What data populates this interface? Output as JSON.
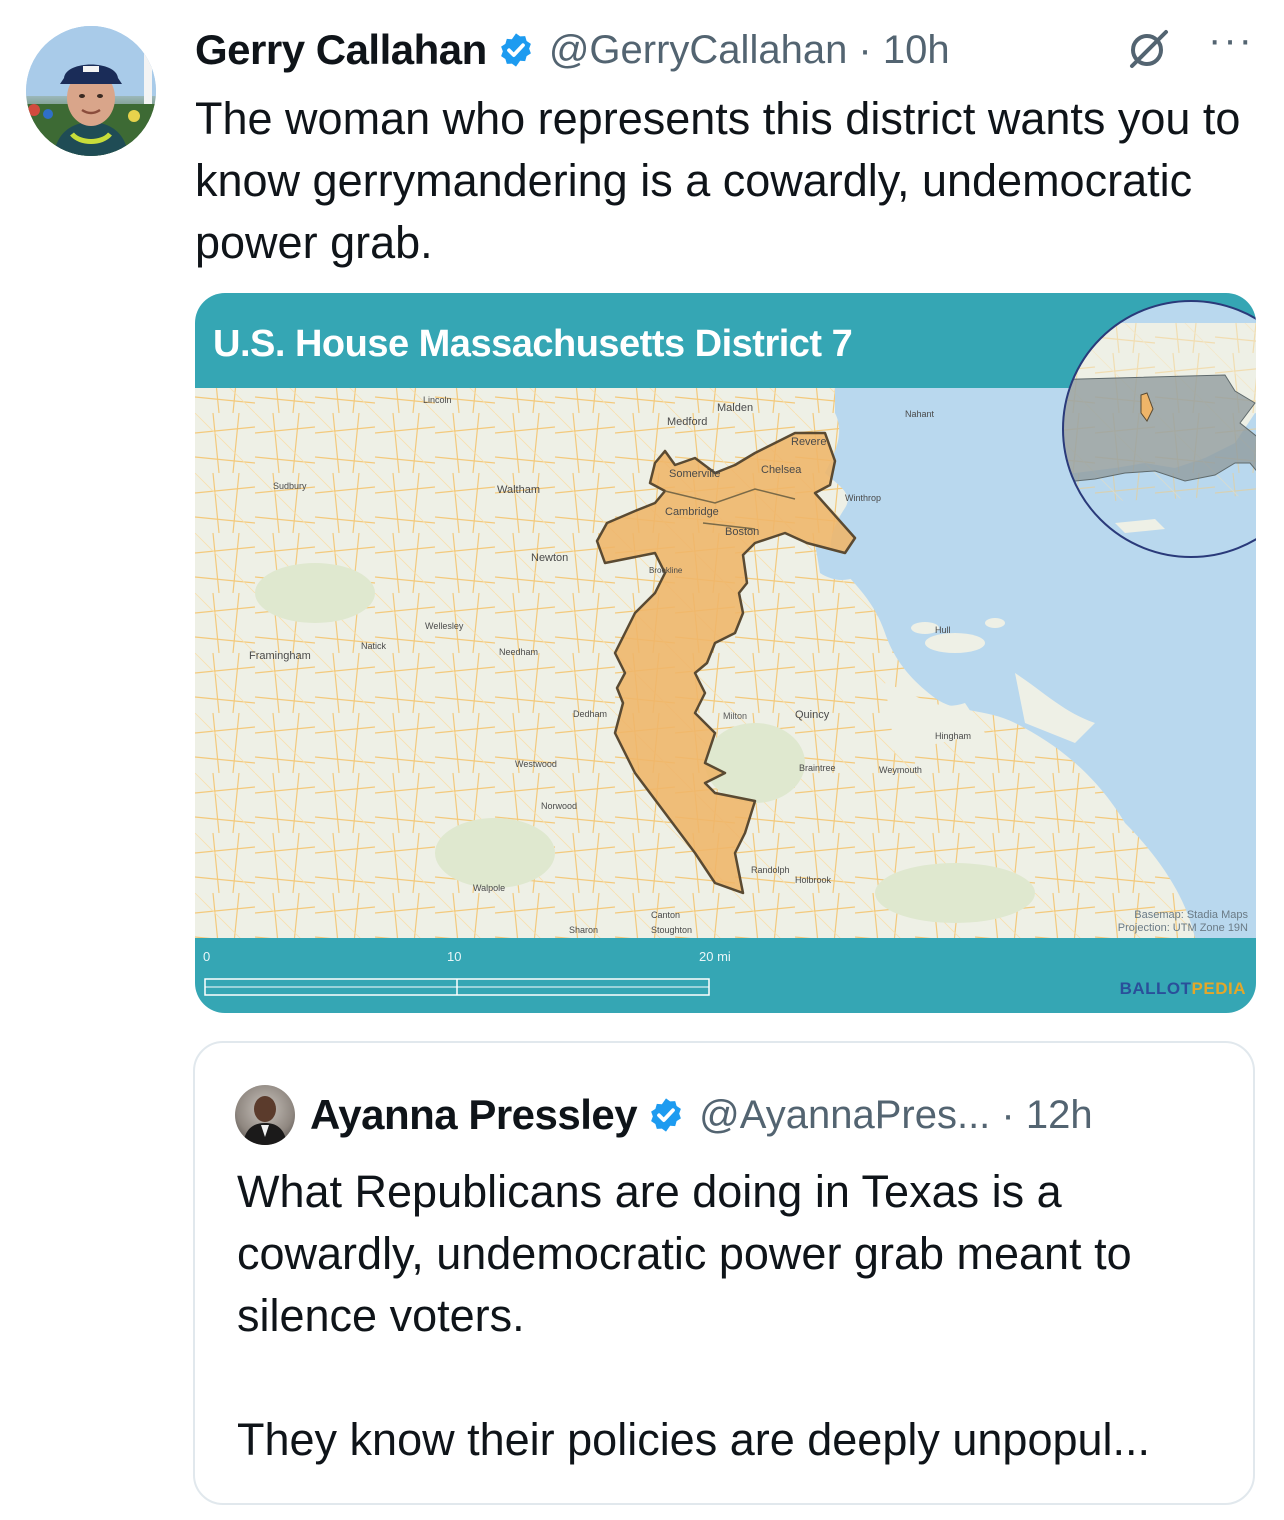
{
  "tweet": {
    "author_name": "Gerry Callahan",
    "handle_time": "@GerryCallahan · 10h",
    "text": "The woman who represents this district wants you to know gerrymandering is a cowardly, undemocratic power grab."
  },
  "map": {
    "title": "U.S. House Massachusetts District 7",
    "places": {
      "medford": "Medford",
      "malden": "Malden",
      "revere": "Revere",
      "chelsea": "Chelsea",
      "somerville": "Somerville",
      "waltham": "Waltham",
      "cambridge": "Cambridge",
      "boston": "Boston",
      "newton": "Newton",
      "framingham": "Framingham",
      "quincy": "Quincy",
      "milton": "Milton",
      "dedham": "Dedham",
      "westwood": "Westwood",
      "norwood": "Norwood",
      "needham": "Needham",
      "brookline": "Brookline",
      "braintree": "Braintree",
      "weymouth": "Weymouth",
      "randolph": "Randolph",
      "sharon": "Sharon",
      "stoughton": "Stoughton",
      "canton": "Canton",
      "walpole": "Walpole",
      "sudbury": "Sudbury",
      "wellesley": "Wellesley",
      "natick": "Natick",
      "holbrook": "Holbrook",
      "hingham": "Hingham",
      "hull": "Hull",
      "nahant": "Nahant",
      "winthrop": "Winthrop",
      "lincoln": "Lincoln"
    },
    "scale": {
      "zero": "0",
      "ten": "10",
      "twenty": "20 mi"
    },
    "credit_line1": "Basemap: Stadia Maps",
    "credit_line2": "Projection: UTM Zone 19N",
    "brand_ballot": "BALLOT",
    "brand_pedia": "PEDIA",
    "colors": {
      "frame": "#35a6b4",
      "land": "#eef0e6",
      "water": "#b9d8ee",
      "district_fill": "#efb569",
      "district_stroke": "#5a4a32",
      "roads": "#f3c97c"
    }
  },
  "quote": {
    "author_name": "Ayanna Pressley",
    "handle_time": "@AyannaPres... · 12h",
    "text_para1": "What Republicans are doing in Texas is a cowardly, undemocratic power grab meant to silence voters.",
    "text_para2": "They know their policies are deeply unpopul..."
  },
  "icons": {
    "verified": "verified-badge-icon",
    "grok": "grok-icon",
    "more": "more-options-icon"
  }
}
